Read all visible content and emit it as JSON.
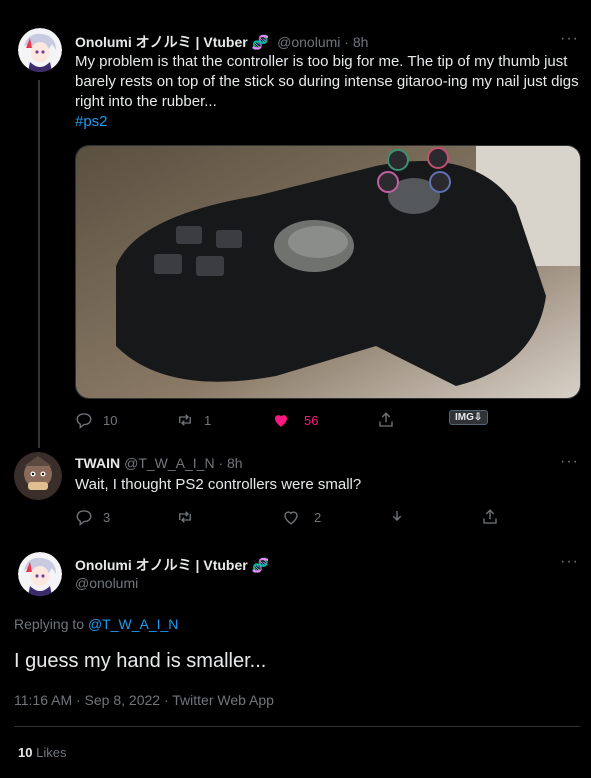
{
  "tweet1": {
    "display_name": "Onolumi オノルミ | Vtuber",
    "handle_time": "@onolumi · 8h",
    "text": "My problem is that the controller is too big for me. The tip of my  thumb just barely rests on top of the stick so during intense gitaroo-ing my nail just digs right into the rubber...",
    "hashtag": "#ps2",
    "replies": "10",
    "retweets": "1",
    "likes": "56",
    "img_badge": "IMG⇩",
    "like_color": "#f91880"
  },
  "tweet2": {
    "display_name": "TWAIN",
    "handle_time": "@T_W_A_I_N · 8h",
    "text": "Wait, I thought PS2 controllers were small?",
    "replies": "3",
    "retweets": "",
    "likes": "2"
  },
  "main": {
    "display_name": "Onolumi オノルミ | Vtuber",
    "handle": "@onolumi",
    "replying_label": "Replying to",
    "replying_to": "@T_W_A_I_N",
    "text": "I guess my hand is smaller...",
    "meta": "11:16 AM · Sep 8, 2022 · Twitter Web App",
    "likes_count": "10",
    "likes_label": "Likes"
  },
  "more_label": "···",
  "colors": {
    "accent": "#1d9bf0",
    "background": "#000000"
  }
}
